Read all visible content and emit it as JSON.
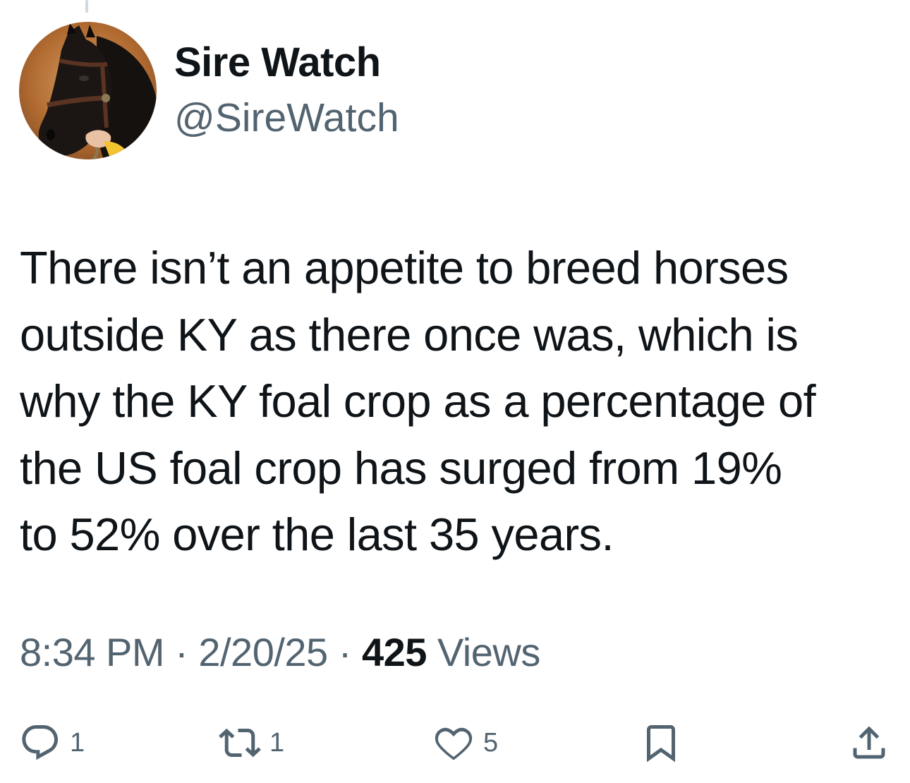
{
  "author": {
    "display_name": "Sire Watch",
    "handle": "@SireWatch",
    "avatar_icon": "horse-head-avatar"
  },
  "tweet": {
    "text": "There isn’t an appetite to breed horses\noutside KY as there once was, which is\nwhy the KY foal crop as a percentage of\nthe US foal crop has surged from 19%\nto 52% over the last 35 years."
  },
  "meta": {
    "time": "8:34 PM",
    "separator": "·",
    "date": "2/20/25",
    "views_count": "425",
    "views_label": "Views"
  },
  "actions": {
    "reply": {
      "icon": "reply-icon",
      "count": "1"
    },
    "retweet": {
      "icon": "retweet-icon",
      "count": "1"
    },
    "like": {
      "icon": "heart-icon",
      "count": "5"
    },
    "bookmark": {
      "icon": "bookmark-icon"
    },
    "share": {
      "icon": "share-icon"
    }
  },
  "colors": {
    "text_primary": "#0f1419",
    "text_secondary": "#536471",
    "thread_line": "#cfd9de"
  }
}
